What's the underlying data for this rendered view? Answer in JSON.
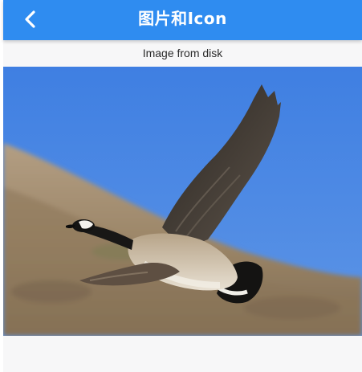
{
  "app_bar": {
    "title": "图片和Icon",
    "back_icon": "chevron-left-icon",
    "color": "#2f8cf0"
  },
  "content": {
    "caption": "Image from disk",
    "image_subject": "goose-photo"
  }
}
